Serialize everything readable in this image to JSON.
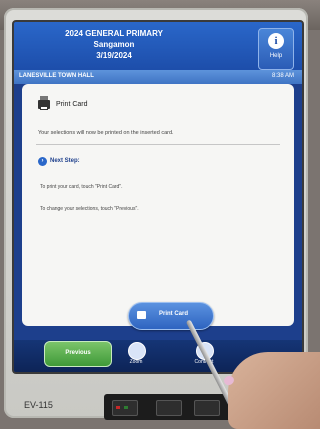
{
  "screen": {
    "election_title": "2024 GENERAL PRIMARY",
    "county": "Sangamon",
    "date": "3/19/2024",
    "help_label": "Help",
    "location": "LANESVILLE TOWN HALL",
    "time": "8:38 AM"
  },
  "panel": {
    "title": "Print Card",
    "description": "Your selections will now be printed on the inserted card.",
    "next_step_title": "Next Step:",
    "instruction_print": "To print your card, touch \"Print Card\".",
    "instruction_change": "To change your selections, touch \"Previous\"."
  },
  "buttons": {
    "print_card": "Print Card",
    "previous": "Previous",
    "zoom": "Zoom",
    "contrast": "Contrast"
  },
  "device": {
    "model": "EV-115"
  },
  "colors": {
    "accent": "#2a67c9",
    "header": "#1b4aa6",
    "previous_button": "#3f9a38"
  }
}
